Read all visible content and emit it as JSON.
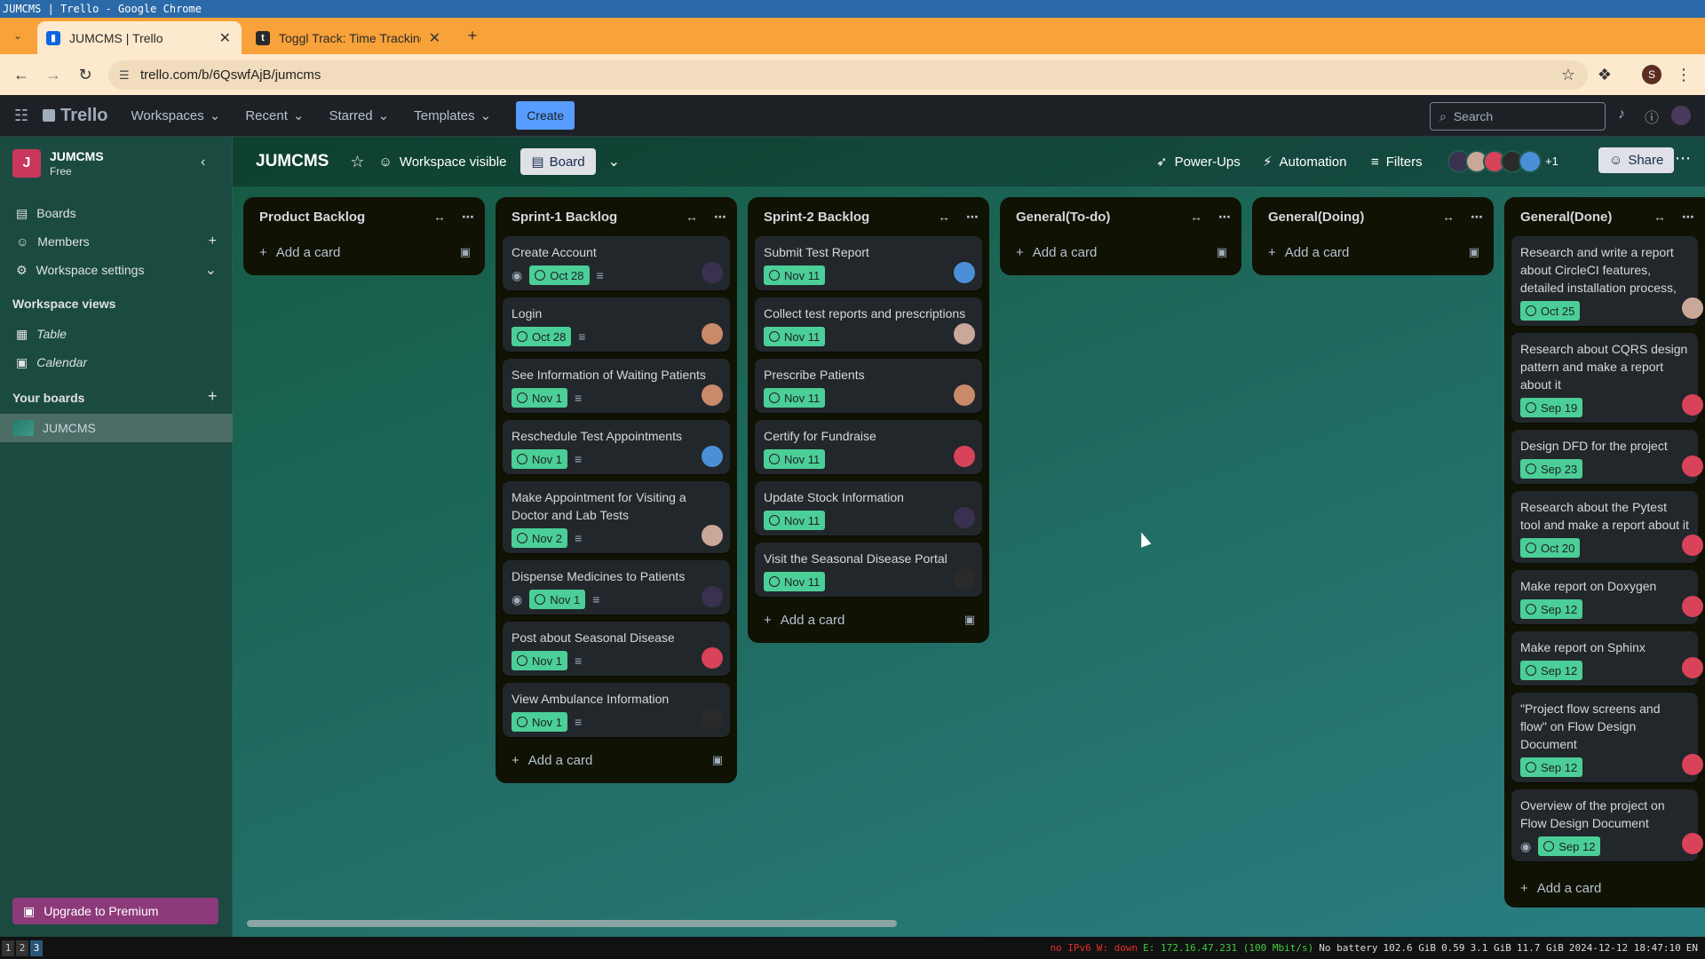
{
  "window_title": "JUMCMS | Trello - Google Chrome",
  "browser": {
    "tabs": [
      {
        "title": "JUMCMS | Trello",
        "active": true
      },
      {
        "title": "Toggl Track: Time Tracking S",
        "active": false
      }
    ],
    "url": "trello.com/b/6QswfAjB/jumcms",
    "profile_initial": "S"
  },
  "header": {
    "logo": "Trello",
    "menus": [
      "Workspaces",
      "Recent",
      "Starred",
      "Templates"
    ],
    "create_label": "Create",
    "search_placeholder": "Search"
  },
  "sidebar": {
    "workspace_initial": "J",
    "workspace_name": "JUMCMS",
    "workspace_plan": "Free",
    "items": [
      "Boards",
      "Members",
      "Workspace settings"
    ],
    "views_heading": "Workspace views",
    "views": [
      "Table",
      "Calendar"
    ],
    "boards_heading": "Your boards",
    "boards": [
      "JUMCMS"
    ],
    "upgrade_label": "Upgrade to Premium"
  },
  "board": {
    "name": "JUMCMS",
    "visibility": "Workspace visible",
    "view": "Board",
    "powerups": "Power-Ups",
    "automation": "Automation",
    "filters": "Filters",
    "extra_members": "+1",
    "share": "Share"
  },
  "add_card_label": "Add a card",
  "lists": [
    {
      "name": "Product Backlog",
      "cards": []
    },
    {
      "name": "Sprint-1 Backlog",
      "cards": [
        {
          "title": "Create Account",
          "due": "Oct 28",
          "watch": true,
          "desc": true
        },
        {
          "title": "Login",
          "due": "Oct 28",
          "desc": true
        },
        {
          "title": "See Information of Waiting Patients",
          "due": "Nov 1",
          "desc": true
        },
        {
          "title": "Reschedule Test Appointments",
          "due": "Nov 1",
          "desc": true
        },
        {
          "title": "Make Appointment for Visiting a Doctor and Lab Tests",
          "due": "Nov 2",
          "desc": true
        },
        {
          "title": "Dispense Medicines to Patients",
          "due": "Nov 1",
          "watch": true,
          "desc": true
        },
        {
          "title": "Post about Seasonal Disease",
          "due": "Nov 1",
          "desc": true
        },
        {
          "title": "View Ambulance Information",
          "due": "Nov 1",
          "desc": true
        }
      ]
    },
    {
      "name": "Sprint-2 Backlog",
      "cards": [
        {
          "title": "Submit Test Report",
          "due": "Nov 11"
        },
        {
          "title": "Collect test reports and prescriptions",
          "due": "Nov 11"
        },
        {
          "title": "Prescribe Patients",
          "due": "Nov 11"
        },
        {
          "title": "Certify for Fundraise",
          "due": "Nov 11"
        },
        {
          "title": "Update Stock Information",
          "due": "Nov 11"
        },
        {
          "title": "Visit the Seasonal Disease Portal",
          "due": "Nov 11"
        }
      ]
    },
    {
      "name": "General(To-do)",
      "cards": []
    },
    {
      "name": "General(Doing)",
      "cards": []
    },
    {
      "name": "General(Done)",
      "cards": [
        {
          "title": "Research and write a report about CircleCI features, detailed installation process, pros and cons",
          "due": "Oct 25"
        },
        {
          "title": "Research about CQRS design pattern and make a report about it",
          "due": "Sep 19"
        },
        {
          "title": "Design DFD for the project",
          "due": "Sep 23"
        },
        {
          "title": "Research about the Pytest tool and make a report about it",
          "due": "Oct 20"
        },
        {
          "title": "Make report on Doxygen",
          "due": "Sep 12"
        },
        {
          "title": "Make report on Sphinx",
          "due": "Sep 12"
        },
        {
          "title": "\"Project flow screens and flow\" on Flow Design Document",
          "due": "Sep 12"
        },
        {
          "title": "Overview of the project on Flow Design Document",
          "due": "Sep 12",
          "watch": true
        }
      ]
    }
  ],
  "taskbar": {
    "workspaces": [
      "1",
      "2",
      "3"
    ],
    "status_items": [
      "no IPv6",
      "W: down",
      "E: 172.16.47.231 (100 Mbit/s)",
      "No battery",
      "102.6 GiB",
      "0.59",
      "3.1 GiB",
      "11.7 GiB",
      "2024-12-12 18:47:10",
      "EN"
    ]
  }
}
